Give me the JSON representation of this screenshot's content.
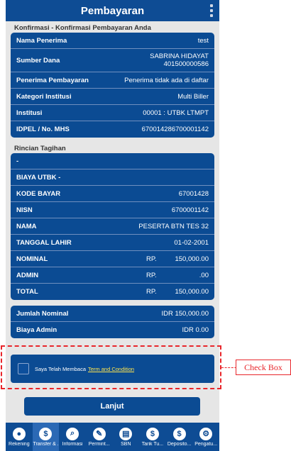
{
  "header": {
    "title": "Pembayaran"
  },
  "confirm": {
    "section_label": "Konfirmasi - Konfirmasi Pembayaran Anda",
    "rows": [
      {
        "label": "Nama Penerima",
        "value": "test"
      },
      {
        "label": "Sumber Dana",
        "value": "SABRINA HIDAYAT",
        "value2": "401500000586"
      },
      {
        "label": "Penerima Pembayaran",
        "value": "Penerima tidak ada di daftar"
      },
      {
        "label": "Kategori Institusi",
        "value": "Multi Biller"
      },
      {
        "label": "Institusi",
        "value": "00001 : UTBK LTMPT"
      },
      {
        "label": "IDPEL / No. MHS",
        "value": "670014286700001142"
      }
    ]
  },
  "rincian": {
    "section_label": "Rincian Tagihan",
    "rows": [
      {
        "label": "-",
        "value": ""
      },
      {
        "label": "BIAYA UTBK -",
        "value": ""
      },
      {
        "label": "KODE BAYAR",
        "value": "67001428"
      },
      {
        "label": "NISN",
        "value": "6700001142"
      },
      {
        "label": "NAMA",
        "value": "PESERTA BTN TES 32"
      },
      {
        "label": "TANGGAL LAHIR",
        "value": "01-02-2001"
      },
      {
        "label": "NOMINAL",
        "currency": "RP.",
        "amount": "150,000.00"
      },
      {
        "label": "ADMIN",
        "currency": "RP.",
        "amount": ".00"
      },
      {
        "label": "TOTAL",
        "currency": "RP.",
        "amount": "150,000.00"
      }
    ]
  },
  "summary": {
    "rows": [
      {
        "label": "Jumlah Nominal",
        "value": "IDR 150,000.00"
      },
      {
        "label": "Biaya Admin",
        "value": "IDR 0.00"
      }
    ]
  },
  "agreement": {
    "text": "Saya Telah Membaca",
    "link": "Term and Condition",
    "checked": false
  },
  "submit": {
    "label": "Lanjut"
  },
  "nav": {
    "items": [
      {
        "label": "Rekening",
        "icon": "account-icon",
        "glyph": "●"
      },
      {
        "label": "Transfer & ...",
        "icon": "transfer-icon",
        "glyph": "$"
      },
      {
        "label": "Informasi",
        "icon": "search-icon",
        "glyph": "⌕"
      },
      {
        "label": "Permint...",
        "icon": "request-icon",
        "glyph": "✎"
      },
      {
        "label": "SBN",
        "icon": "document-icon",
        "glyph": "▤"
      },
      {
        "label": "Tarik Tu...",
        "icon": "withdraw-icon",
        "glyph": "$"
      },
      {
        "label": "Deposito...",
        "icon": "deposit-icon",
        "glyph": "$"
      },
      {
        "label": "Pengatu...",
        "icon": "gear-icon",
        "glyph": "⚙"
      }
    ],
    "active_index": 1
  },
  "annotation": {
    "label": "Check Box"
  },
  "colors": {
    "primary": "#0b4b93",
    "accent_link": "#ffe44d",
    "annotation": "#e8262b"
  }
}
